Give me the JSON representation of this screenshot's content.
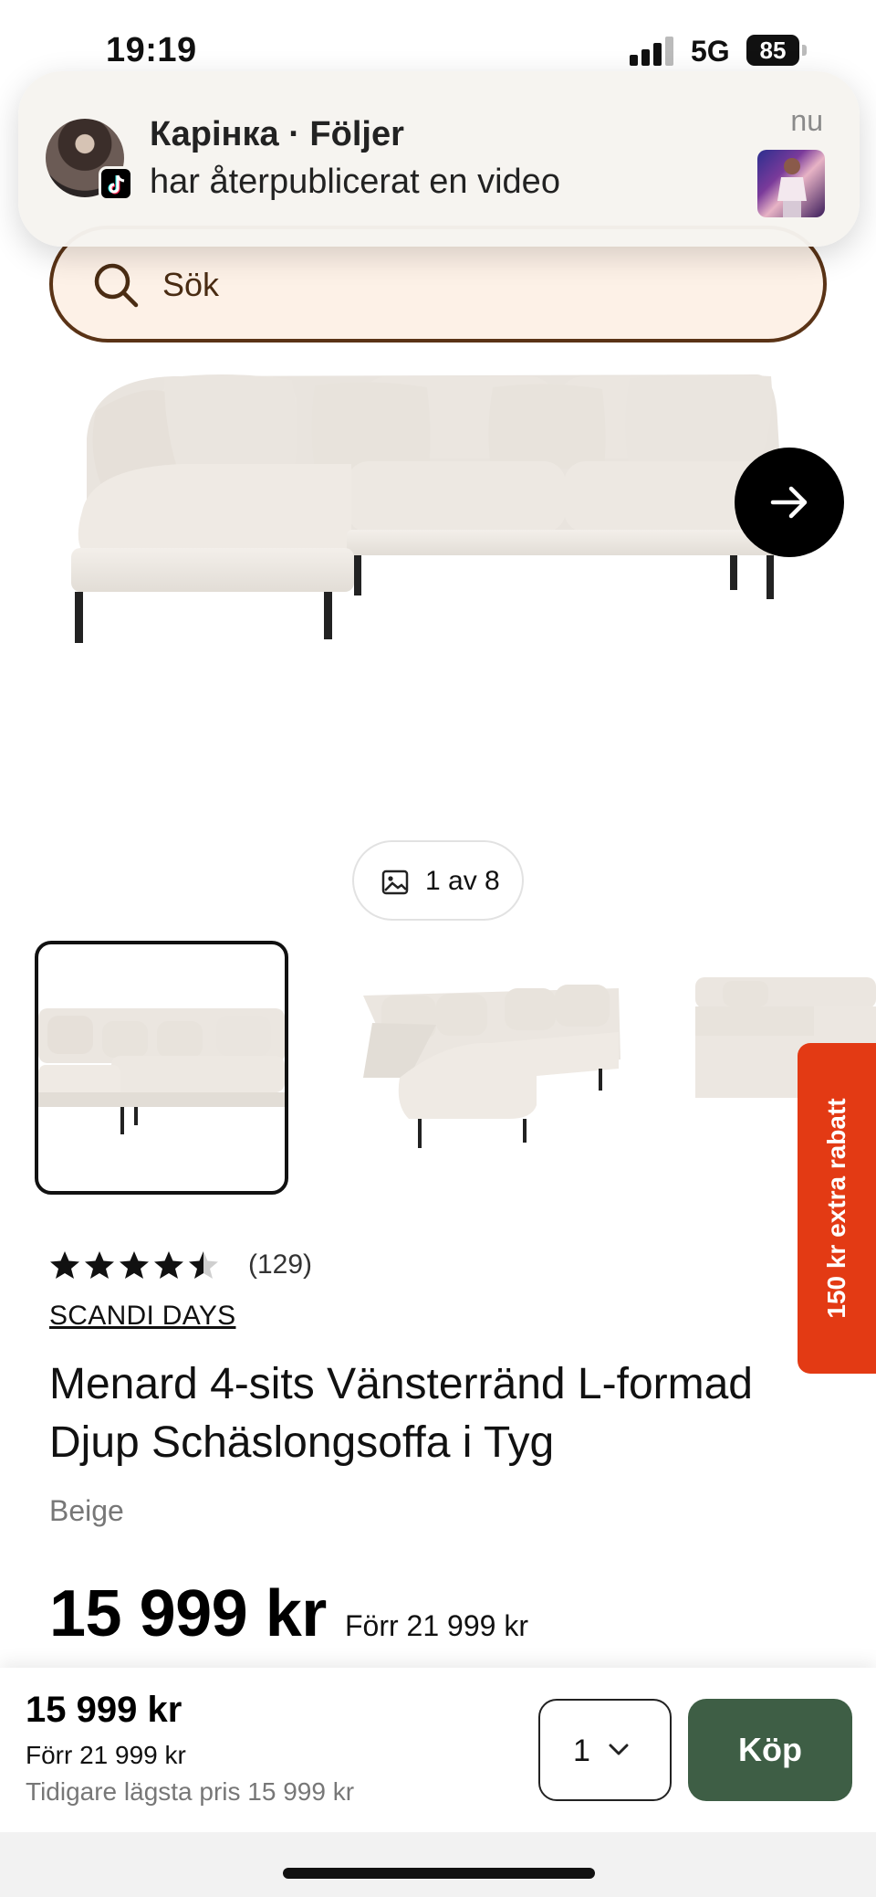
{
  "status": {
    "time": "19:19",
    "network": "5G",
    "battery": "85"
  },
  "search": {
    "placeholder": "Sök"
  },
  "notification": {
    "title": "Карінка · Följer",
    "body": "har återpublicerat en video",
    "time": "nu",
    "app_icon": "tiktok-icon"
  },
  "gallery": {
    "counter": "1 av 8",
    "next_icon": "arrow-right-icon"
  },
  "product": {
    "rating": 4.5,
    "review_count": "(129)",
    "brand": "SCANDI DAYS",
    "title": "Menard 4-sits Vänsterränd L-formad Djup Schäslongsoffa i Tyg",
    "variant": "Beige",
    "price": "15 999 kr",
    "old_price": "Förr 21 999 kr"
  },
  "promo": {
    "label": "150 kr extra rabatt"
  },
  "bottom_bar": {
    "price": "15 999 kr",
    "old_price": "Förr 21 999 kr",
    "lowest_price": "Tidigare lägsta pris 15 999 kr",
    "quantity": "1",
    "buy_label": "Köp"
  },
  "colors": {
    "brand_brown": "#5a3316",
    "search_bg": "#fdf1e7",
    "buy_green": "#3e5e45",
    "promo_red": "#e33a14"
  }
}
